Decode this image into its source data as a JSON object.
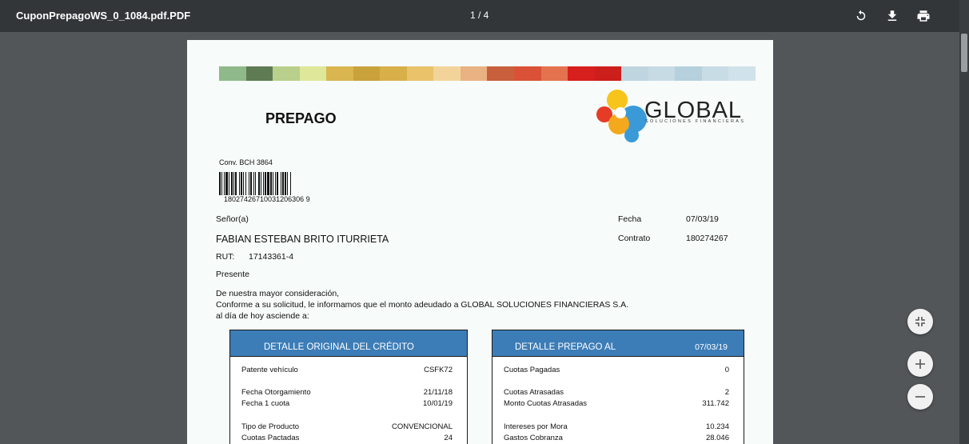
{
  "toolbar": {
    "file_name": "CuponPrepagoWS_0_1084.pdf.PDF",
    "page_indicator": "1 / 4",
    "icons": [
      "rotate-icon",
      "download-icon",
      "print-icon"
    ]
  },
  "document": {
    "title": "PREPAGO",
    "logo": {
      "name": "GLOBAL",
      "tagline": "SOLUCIONES FINANCIERAS"
    },
    "conv": "Conv. BCH 3864",
    "barcode_number": "18027426710031206306 9",
    "salutation": "Señor(a)",
    "client_name": "FABIAN ESTEBAN BRITO ITURRIETA",
    "rut_label": "RUT:",
    "rut_value": "17143361-4",
    "presente": "Presente",
    "fecha_label": "Fecha",
    "fecha_value": "07/03/19",
    "contrato_label": "Contrato",
    "contrato_value": "180274267",
    "body_lines": [
      "De nuestra mayor consideración,",
      "Conforme a su solicitud, le informamos que el monto adeudado a GLOBAL SOLUCIONES FINANCIERAS S.A.",
      "al día de hoy asciende a:"
    ],
    "left_box": {
      "header": "DETALLE ORIGINAL DEL CRÉDITO",
      "rows": [
        {
          "label": "Patente vehículo",
          "value": "CSFK72"
        },
        {
          "label": "Fecha Otorgamiento",
          "value": "21/11/18"
        },
        {
          "label": "Fecha 1 cuota",
          "value": "10/01/19"
        },
        {
          "label": "Tipo de Producto",
          "value": "CONVENCIONAL"
        },
        {
          "label": "Cuotas Pactadas",
          "value": "24"
        }
      ]
    },
    "right_box": {
      "header": "DETALLE PREPAGO AL",
      "header_date": "07/03/19",
      "rows": [
        {
          "label": "Cuotas Pagadas",
          "value": "0"
        },
        {
          "label": "Cuotas Atrasadas",
          "value": "2"
        },
        {
          "label": "Monto Cuotas Atrasadas",
          "value": "311.742"
        },
        {
          "label": "Intereses por Mora",
          "value": "10.234"
        },
        {
          "label": "Gastos Cobranza",
          "value": "28.046"
        }
      ]
    }
  },
  "colors": {
    "toolbar_bg": "#323639",
    "viewer_bg": "#525659",
    "box_header": "#3d7db7"
  }
}
